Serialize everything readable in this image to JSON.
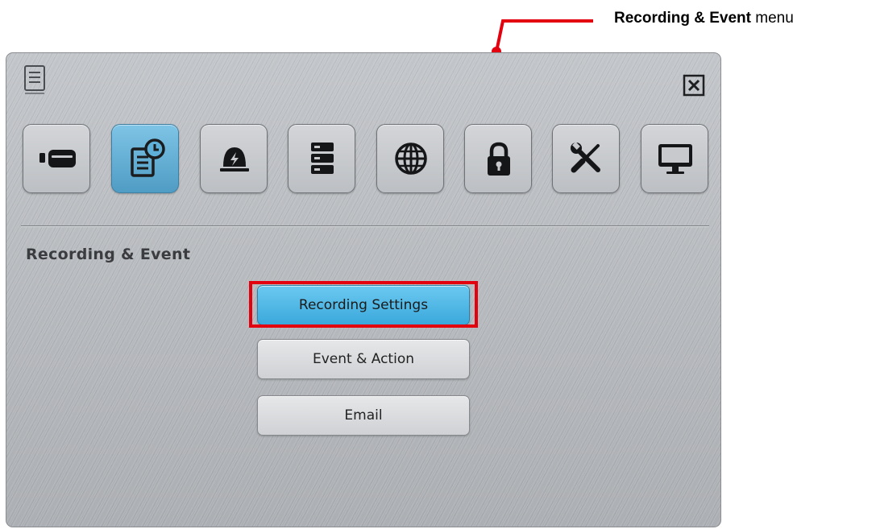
{
  "callout": {
    "bold_text": "Recording & Event",
    "rest_text": " menu",
    "color": "#e3000f"
  },
  "panel": {
    "header_icon": "menu-document-icon",
    "close_icon": "close-x-icon",
    "toolbar": [
      {
        "icon": "camera-device-icon",
        "active": false
      },
      {
        "icon": "recording-schedule-icon",
        "active": true
      },
      {
        "icon": "alarm-siren-icon",
        "active": false
      },
      {
        "icon": "storage-server-icon",
        "active": false
      },
      {
        "icon": "network-globe-icon",
        "active": false
      },
      {
        "icon": "security-lock-icon",
        "active": false
      },
      {
        "icon": "tools-wrench-screwdriver-icon",
        "active": false
      },
      {
        "icon": "display-monitor-icon",
        "active": false
      }
    ],
    "section_title": "Recording & Event",
    "buttons": [
      {
        "label": "Recording Settings",
        "highlighted": true
      },
      {
        "label": "Event & Action",
        "highlighted": false
      },
      {
        "label": "Email",
        "highlighted": false
      }
    ],
    "active_color": "#4f9cc4",
    "highlight_color": "#e3000f"
  }
}
